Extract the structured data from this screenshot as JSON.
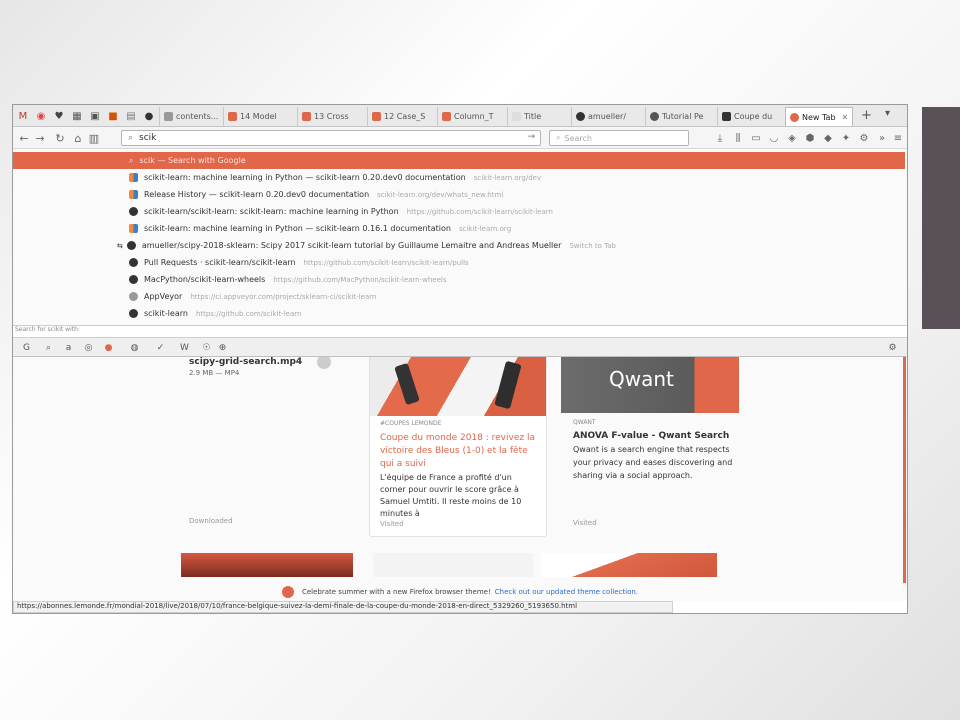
{
  "tabs": [
    {
      "label": "contents...",
      "color": "#999999"
    },
    {
      "label": "14 Model",
      "color": "#e0674a"
    },
    {
      "label": "13 Cross",
      "color": "#e0674a"
    },
    {
      "label": "12 Case_S",
      "color": "#e0674a"
    },
    {
      "label": "Column_T",
      "color": "#e0674a"
    },
    {
      "label": "Title",
      "color": "#cccccc"
    },
    {
      "label": "amueller/",
      "color": "#333333"
    },
    {
      "label": "Tutorial Pe",
      "color": "#555555"
    },
    {
      "label": "Coupe du",
      "color": "#333333"
    },
    {
      "label": "New Tab",
      "color": "#e0674a"
    }
  ],
  "new_tab_label": "+",
  "url": {
    "value": "scik",
    "placeholder": ""
  },
  "search": {
    "placeholder": "Search"
  },
  "dropdown": {
    "selected_text": "scik — Search with Google",
    "rows": [
      {
        "icon": "sk",
        "title": "scikit-learn: machine learning in Python — scikit-learn 0.20.dev0 documentation",
        "url": "scikit-learn.org/dev"
      },
      {
        "icon": "sk",
        "title": "Release History — scikit-learn 0.20.dev0 documentation",
        "url": "scikit-learn.org/dev/whats_new.html"
      },
      {
        "icon": "gh",
        "title": "scikit-learn/scikit-learn: scikit-learn: machine learning in Python",
        "url": "https://github.com/scikit-learn/scikit-learn"
      },
      {
        "icon": "sk",
        "title": "scikit-learn: machine learning in Python — scikit-learn 0.16.1 documentation",
        "url": "scikit-learn.org"
      },
      {
        "icon": "gh",
        "title": "amueller/scipy-2018-sklearn: Scipy 2017 scikit-learn tutorial by Guillaume Lemaitre and Andreas Mueller",
        "url": "Switch to Tab"
      },
      {
        "icon": "gh",
        "title": "Pull Requests · scikit-learn/scikit-learn",
        "url": "https://github.com/scikit-learn/scikit-learn/pulls"
      },
      {
        "icon": "gh",
        "title": "MacPython/scikit-learn-wheels",
        "url": "https://github.com/MacPython/scikit-learn-wheels"
      },
      {
        "icon": "av",
        "title": "AppVeyor",
        "url": "https://ci.appveyor.com/project/sklearn-ci/scikit-learn"
      },
      {
        "icon": "gh",
        "title": "scikit-learn",
        "url": "https://github.com/scikit-learn"
      }
    ],
    "oneoffs_label": "Search for scikit with:"
  },
  "download": {
    "filename": "scipy-grid-search.mp4",
    "meta": "2.9 MB — MP4",
    "status": "Downloaded"
  },
  "lemonde_card": {
    "source": "#COUPES LEMONDE",
    "title": "Coupe du monde 2018 : revivez la victoire des Bleus (1-0) et la fête qui a suivi",
    "desc": "L'équipe de France a profité d'un corner pour ouvrir le score grâce à Samuel Umtiti. Il reste moins de 10 minutes à",
    "status": "Visited"
  },
  "qwant_card": {
    "logo": "Qwant",
    "source": "QWANT",
    "title": "ANOVA F-value - Qwant Search",
    "desc": "Qwant is a search engine that respects your privacy and eases discovering and sharing via a social approach.",
    "status": "Visited"
  },
  "theme_banner": {
    "text": "Celebrate summer with a new Firefox browser theme!",
    "link": "Check out our updated theme collection."
  },
  "status_url": "https://abonnes.lemonde.fr/mondial-2018/live/2018/07/10/france-belgique-suivez-la-demi-finale-de-la-coupe-du-monde-2018-en-direct_5329260_5193650.html"
}
